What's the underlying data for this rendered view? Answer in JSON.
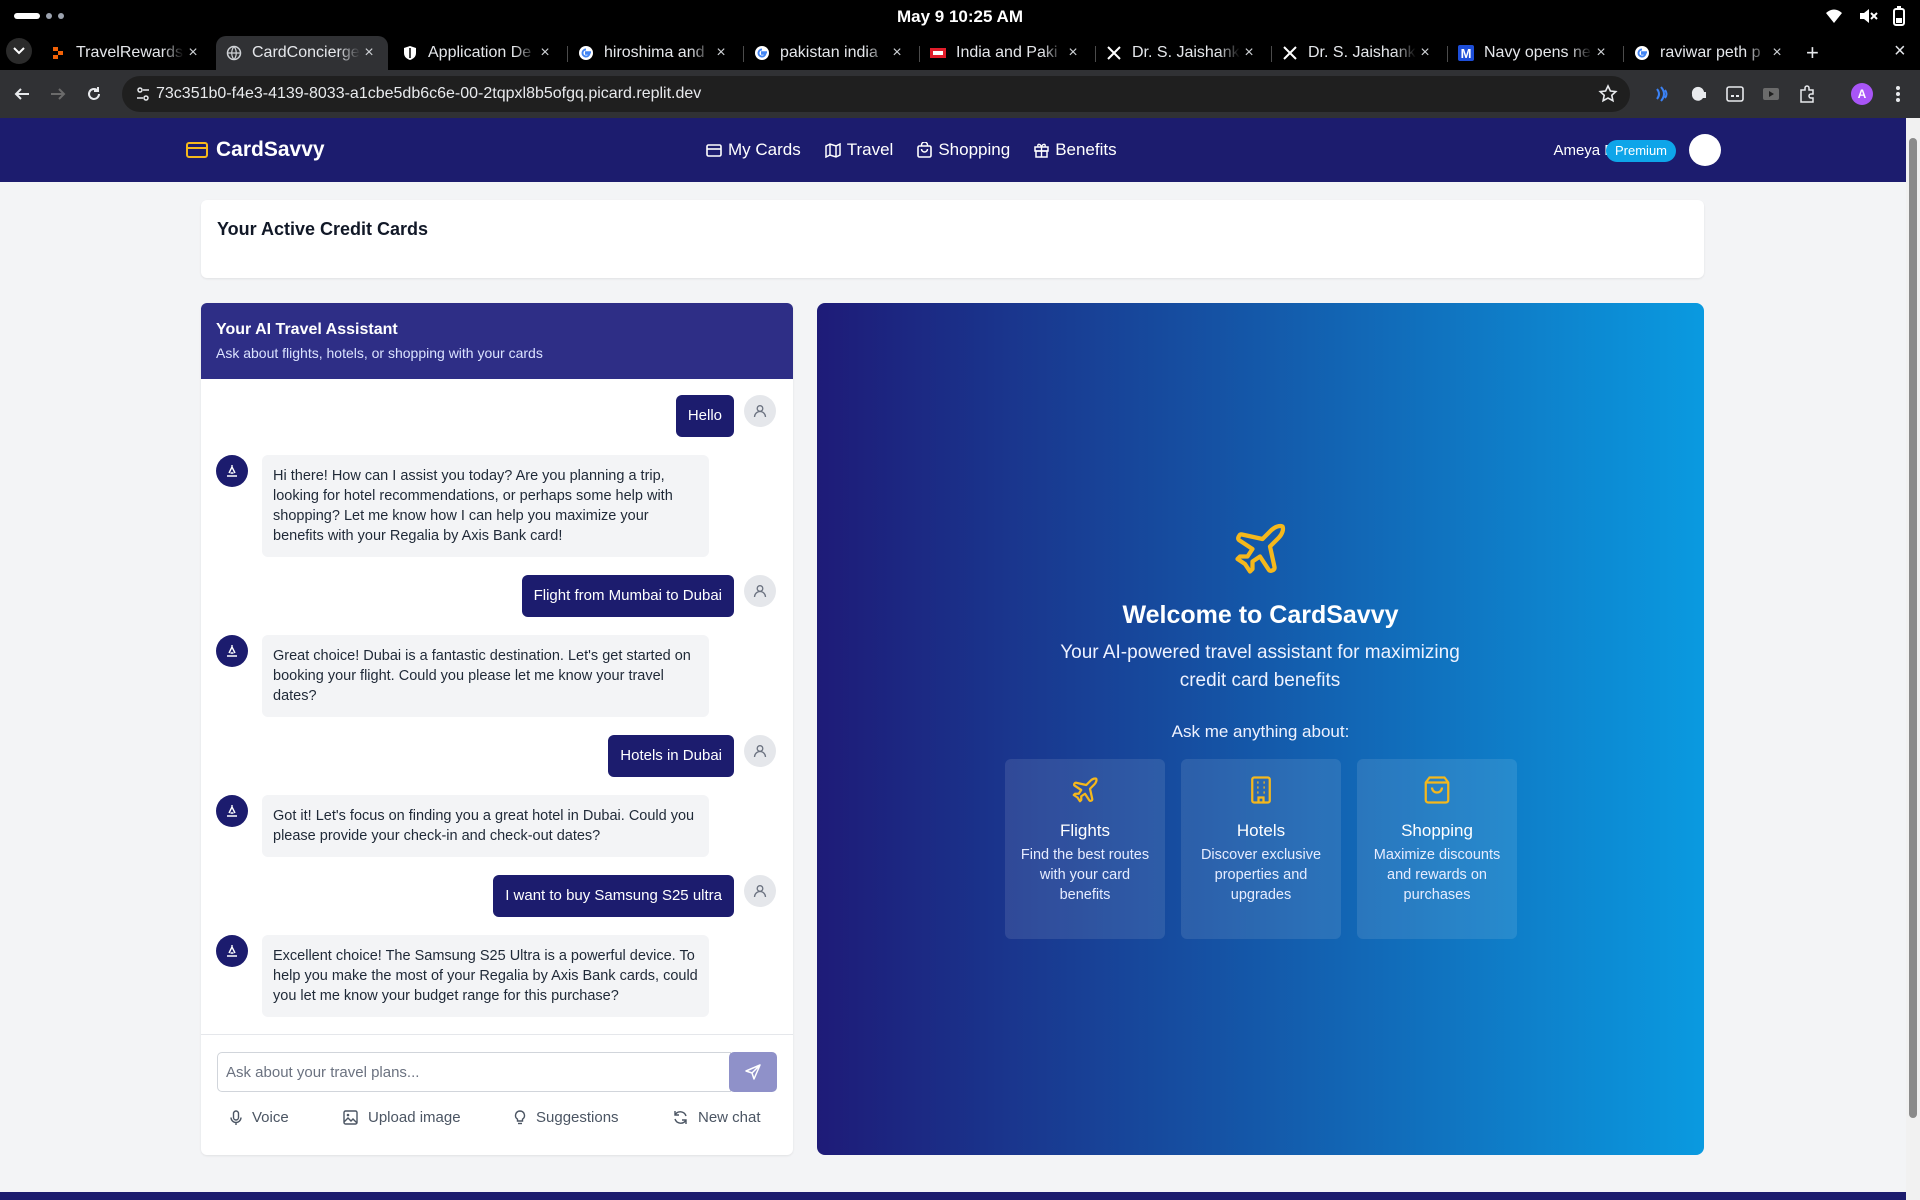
{
  "os": {
    "clock": "May 9  10:25 AM"
  },
  "browser": {
    "tabs": [
      {
        "title": "TravelRewards",
        "favicon": "replit-icon"
      },
      {
        "title": "CardConcierge",
        "favicon": "globe-icon"
      },
      {
        "title": "Application De",
        "favicon": "shield-icon"
      },
      {
        "title": "hiroshima and",
        "favicon": "google-icon"
      },
      {
        "title": "pakistan india",
        "favicon": "google-icon"
      },
      {
        "title": "India and Paki",
        "favicon": "news-icon"
      },
      {
        "title": "Dr. S. Jaishank",
        "favicon": "x-icon"
      },
      {
        "title": "Dr. S. Jaishank",
        "favicon": "x-icon"
      },
      {
        "title": "Navy opens ne",
        "favicon": "m-icon"
      },
      {
        "title": "raviwar peth p",
        "favicon": "google-icon"
      }
    ],
    "close_glyph": "×",
    "new_tab_glyph": "+",
    "url": "73c351b0-f4e3-4139-8033-a1cbe5db6c6e-00-2tqpxl8b5ofgq.picard.replit.dev",
    "profile_initial": "A"
  },
  "app": {
    "brand": "CardSavvy",
    "nav": [
      "My Cards",
      "Travel",
      "Shopping",
      "Benefits"
    ],
    "user_name": "Ameya Dusane",
    "user_badge": "Premium",
    "active_cards_title": "Your Active Credit Cards",
    "chat": {
      "title": "Your AI Travel Assistant",
      "subtitle": "Ask about flights, hotels, or shopping with your cards",
      "messages": [
        {
          "role": "user",
          "text": "Hello"
        },
        {
          "role": "bot",
          "text": "Hi there! How can I assist you today? Are you planning a trip, looking for hotel recommendations, or perhaps some help with shopping? Let me know how I can help you maximize your benefits with your Regalia by Axis Bank card!"
        },
        {
          "role": "user",
          "text": "Flight from Mumbai to Dubai"
        },
        {
          "role": "bot",
          "text": "Great choice! Dubai is a fantastic destination. Let's get started on booking your flight. Could you please let me know your travel dates?"
        },
        {
          "role": "user",
          "text": "Hotels in Dubai"
        },
        {
          "role": "bot",
          "text": "Got it! Let's focus on finding you a great hotel in Dubai. Could you please provide your check-in and check-out dates?"
        },
        {
          "role": "user",
          "text": "I want to buy Samsung S25 ultra"
        },
        {
          "role": "bot",
          "text": "Excellent choice! The Samsung S25 Ultra is a powerful device. To help you make the most of your Regalia by Axis Bank cards, could you let me know your budget range for this purchase?"
        }
      ],
      "input_placeholder": "Ask about your travel plans...",
      "tools": [
        "Voice",
        "Upload image",
        "Suggestions",
        "New chat"
      ]
    },
    "welcome": {
      "title": "Welcome to CardSavvy",
      "subtitle": "Your AI-powered travel assistant for maximizing credit card benefits",
      "ask": "Ask me anything about:",
      "features": [
        {
          "title": "Flights",
          "desc": "Find the best routes with your card benefits",
          "icon": "plane-icon"
        },
        {
          "title": "Hotels",
          "desc": "Discover exclusive properties and upgrades",
          "icon": "building-icon"
        },
        {
          "title": "Shopping",
          "desc": "Maximize discounts and rewards on purchases",
          "icon": "shopping-bag-icon"
        }
      ]
    },
    "colors": {
      "primary": "#1c1c6e",
      "accent": "#f5b81c",
      "badge": "#0ea5e9"
    }
  }
}
